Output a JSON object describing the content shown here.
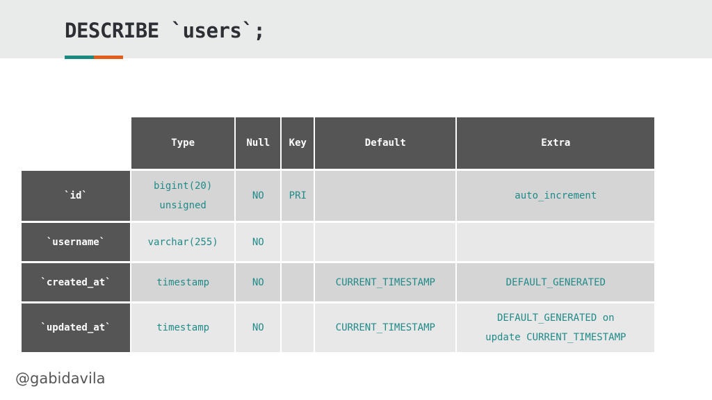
{
  "slide": {
    "title": "DESCRIBE `users`;",
    "accent_colors": [
      "#1a8a80",
      "#e35d1c"
    ],
    "author_handle": "@gabidavila"
  },
  "table": {
    "columns": [
      "Type",
      "Null",
      "Key",
      "Default",
      "Extra"
    ],
    "rows": [
      {
        "field": "`id`",
        "type": "bigint(20) unsigned",
        "null": "NO",
        "key": "PRI",
        "default": "",
        "extra": "auto_increment"
      },
      {
        "field": "`username`",
        "type": "varchar(255)",
        "null": "NO",
        "key": "",
        "default": "",
        "extra": ""
      },
      {
        "field": "`created_at`",
        "type": "timestamp",
        "null": "NO",
        "key": "",
        "default": "CURRENT_TIMESTAMP",
        "extra": "DEFAULT_GENERATED"
      },
      {
        "field": "`updated_at`",
        "type": "timestamp",
        "null": "NO",
        "key": "",
        "default": "CURRENT_TIMESTAMP",
        "extra": "DEFAULT_GENERATED on update CURRENT_TIMESTAMP"
      }
    ]
  }
}
